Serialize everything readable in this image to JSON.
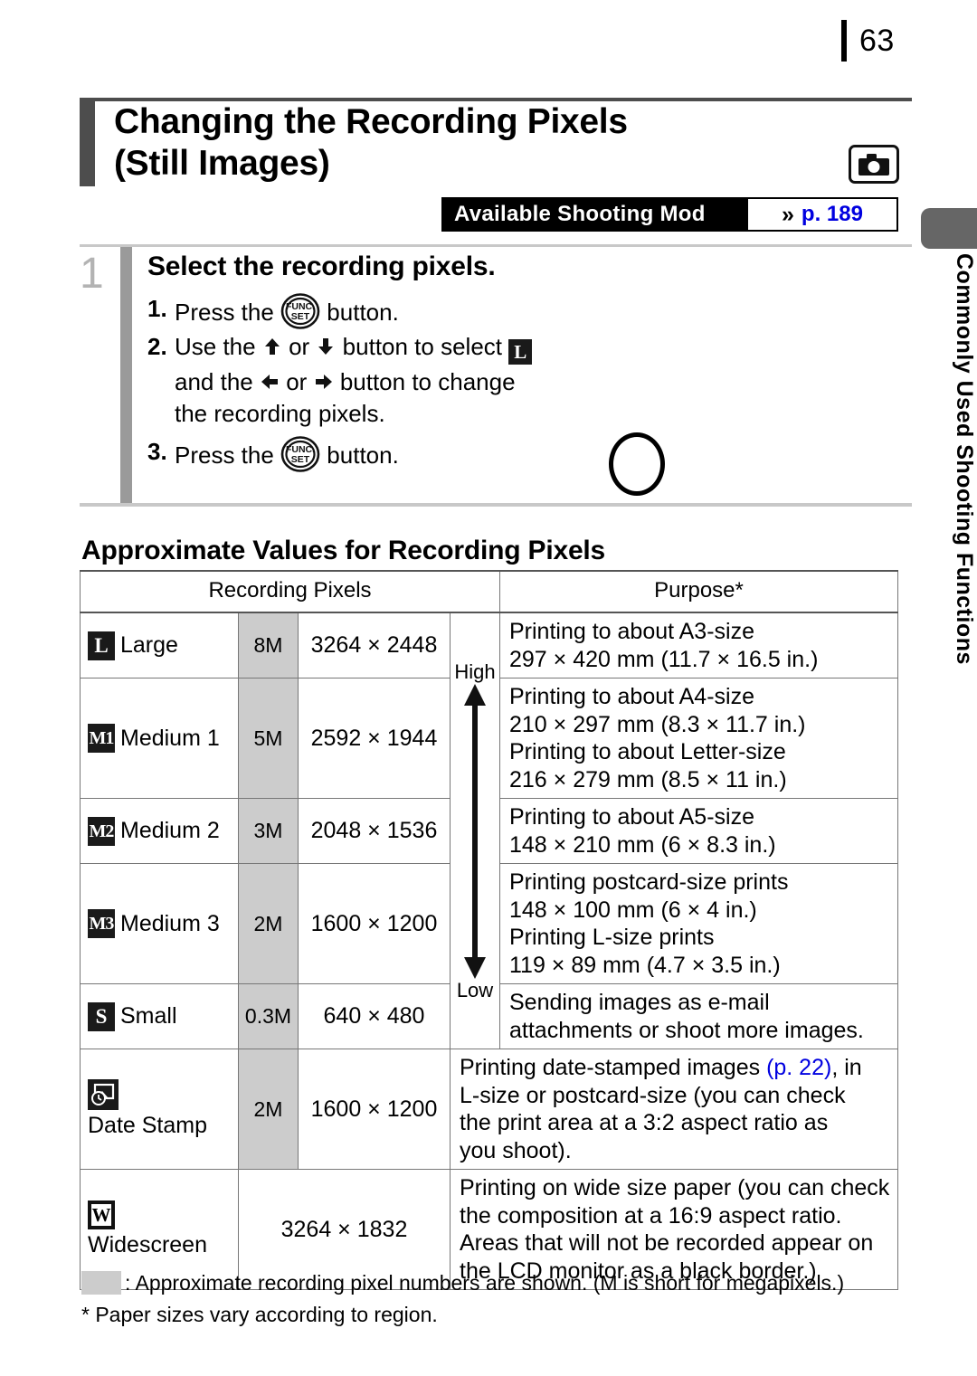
{
  "page_number": "63",
  "side_tab": {
    "label": "Commonly Used Shooting Functions"
  },
  "title": {
    "line1": "Changing the Recording Pixels",
    "line2": "(Still Images)",
    "icon": "camera-icon"
  },
  "modes_badge": {
    "label": "Available Shooting Mod",
    "chevron": "»",
    "page_ref": "p. 189"
  },
  "step": {
    "number": "1",
    "heading": "Select the recording pixels.",
    "items": [
      {
        "n": "1.",
        "before": "Press the",
        "after": "button."
      },
      {
        "n": "2.",
        "before": "Use the",
        "mid_or": "or",
        "after": "button to select",
        "badge": "L",
        "cont1_a": "and the",
        "cont1_or": "or",
        "cont1_b": "button to change",
        "cont2": "the recording pixels."
      },
      {
        "n": "3.",
        "before": "Press the",
        "after": "button."
      }
    ]
  },
  "section_heading": "Approximate Values for Recording Pixels",
  "table": {
    "headers": {
      "left": "Recording Pixels",
      "right": "Purpose*"
    },
    "scale": {
      "high": "High",
      "low": "Low"
    },
    "rows": [
      {
        "icon": "L",
        "icon_style": "solid",
        "label": "Large",
        "mp": "8M",
        "dim": "3264 × 2448",
        "purpose": [
          "Printing to about A3-size",
          "297 × 420 mm (11.7 × 16.5 in.)"
        ]
      },
      {
        "icon": "M1",
        "icon_style": "solid",
        "label": "Medium 1",
        "mp": "5M",
        "dim": "2592 × 1944",
        "purpose": [
          "Printing to about A4-size",
          "210 × 297 mm (8.3 × 11.7 in.)",
          "Printing to about Letter-size",
          "216 × 279 mm (8.5 × 11 in.)"
        ]
      },
      {
        "icon": "M2",
        "icon_style": "solid",
        "label": "Medium 2",
        "mp": "3M",
        "dim": "2048 × 1536",
        "purpose": [
          "Printing to about A5-size",
          "148 × 210 mm (6 × 8.3 in.)"
        ]
      },
      {
        "icon": "M3",
        "icon_style": "solid",
        "label": "Medium 3",
        "mp": "2M",
        "dim": "1600 × 1200",
        "purpose": [
          "Printing postcard-size prints",
          "148 × 100 mm (6 × 4 in.)",
          "Printing L-size prints",
          "119 × 89 mm (4.7 × 3.5 in.)"
        ]
      },
      {
        "icon": "S",
        "icon_style": "solid",
        "label": "Small",
        "mp": "0.3M",
        "dim": "640 × 480",
        "purpose": [
          "Sending images as e-mail",
          "attachments or shoot more images."
        ]
      },
      {
        "icon": "date-stamp-icon",
        "icon_style": "date",
        "label": "Date Stamp",
        "mp": "2M",
        "dim": "1600 × 1200",
        "purpose_rich": {
          "a": "Printing date-stamped images ",
          "link": "(p. 22)",
          "b": ", in",
          "rest": [
            "L-size or postcard-size (you can check",
            "the print area at a 3:2 aspect ratio as",
            "you shoot)."
          ]
        }
      },
      {
        "icon": "W",
        "icon_style": "outline",
        "label": "Widescreen",
        "mp": "",
        "dim": "3264 × 1832",
        "purpose": [
          "Printing on wide size paper (you can check",
          "the composition at a 16:9 aspect ratio.",
          "Areas that will not be recorded appear on",
          "the LCD monitor as a black border.)"
        ]
      }
    ]
  },
  "notes": {
    "note1": ": Approximate recording pixel numbers are shown. (M is short for megapixels.)",
    "note2": "* Paper sizes vary according to region."
  }
}
